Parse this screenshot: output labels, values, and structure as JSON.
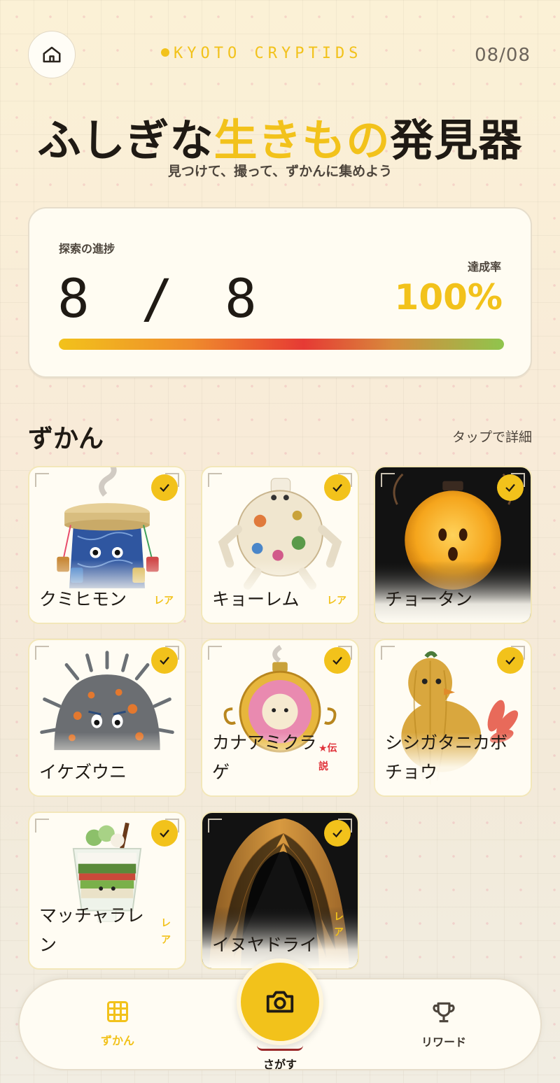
{
  "header": {
    "brand": "KYOTO CRYPTIDS",
    "date": "08/08",
    "title_part1": "ふしぎな",
    "title_accent": "生きもの",
    "title_part2": "発見器",
    "subtitle": "見つけて、撮って、ずかんに集めよう"
  },
  "progress": {
    "label": "探索の進捗",
    "count": "8 / 8",
    "found": 8,
    "total": 8,
    "rate_label": "達成率",
    "rate": "100%",
    "fill_percent": 100
  },
  "collection": {
    "title": "ずかん",
    "hint": "タップで詳細",
    "items": [
      {
        "name": "クミヒモン",
        "tag": "レア",
        "tag_type": "rare"
      },
      {
        "name": "キョーレム",
        "tag": "レア",
        "tag_type": "rare"
      },
      {
        "name": "チョータン",
        "tag": "",
        "tag_type": "none"
      },
      {
        "name": "イケズウニ",
        "tag": "",
        "tag_type": "none"
      },
      {
        "name": "カナアミクラゲ",
        "tag": "★伝説",
        "tag_type": "legend"
      },
      {
        "name": "シシガタニカボチョウ",
        "tag": "",
        "tag_type": "none"
      },
      {
        "name": "マッチャラレン",
        "tag": "レア",
        "tag_type": "rare"
      },
      {
        "name": "イヌヤドライ",
        "tag": "レア",
        "tag_type": "rare"
      }
    ]
  },
  "nav": {
    "zukan_label": "ずかん",
    "camera_label": "さがす",
    "reward_label": "リワード"
  },
  "colors": {
    "accent": "#f2c21b",
    "legend": "#e0323a"
  }
}
